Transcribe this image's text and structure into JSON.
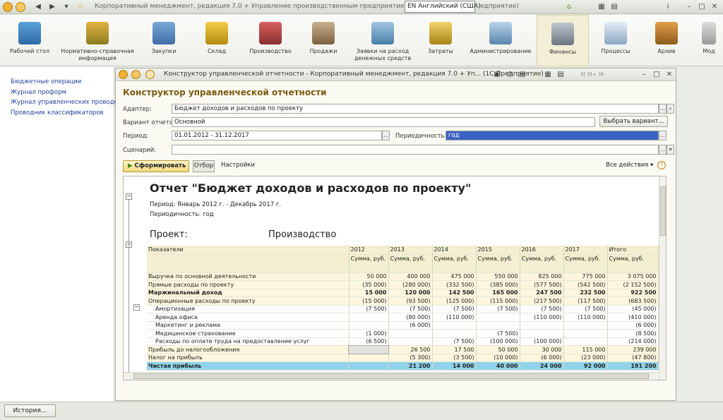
{
  "titlebar": {
    "title": "Корпоративный менеджмент, редакция 7.0 + Управление производственным предприятием, редакция 1.3",
    "language": "EN Английский (США)",
    "title_tail": "едприятие)"
  },
  "toolbar": {
    "items": [
      {
        "label": "Рабочий стол"
      },
      {
        "label": "Нормативно-справочная информация"
      },
      {
        "label": "Закупки"
      },
      {
        "label": "Склад"
      },
      {
        "label": "Производство"
      },
      {
        "label": "Продажи"
      },
      {
        "label": "Заявки на расход денежных средств"
      },
      {
        "label": "Затраты"
      },
      {
        "label": "Администрирование"
      },
      {
        "label": "Финансы"
      },
      {
        "label": "Процессы"
      },
      {
        "label": "Архив"
      },
      {
        "label": "Мод"
      }
    ]
  },
  "sidebar": {
    "items": [
      {
        "label": "Бюджетные операции"
      },
      {
        "label": "Журнал проформ"
      },
      {
        "label": "Журнал управленческих проводок"
      },
      {
        "label": "Проводник классификаторов"
      }
    ]
  },
  "window": {
    "title": "Конструктор управленческой отчетности - Корпоративный менеджмент, редакция 7.0 + Уп...  (1С:Предприятие)",
    "heading": "Конструктор управленческой отчетности",
    "adapter_label": "Адаптер:",
    "adapter_value": "Бюджет доходов и расходов по проекту",
    "variant_label": "Вариант отчета:",
    "variant_value": "Основной",
    "variant_button": "Выбрать вариант...",
    "period_label": "Период:",
    "period_value": "01.01.2012 - 31.12.2017",
    "periodicity_label": "Периодичность:",
    "periodicity_value": "год",
    "scenario_label": "Сценарий:",
    "scenario_value": "",
    "run_button": "Сформировать",
    "filter_button": "Отбор",
    "settings_button": "Настройки",
    "all_actions": "Все действия",
    "help": "?"
  },
  "report": {
    "title": "Отчет \"Бюджет доходов и расходов по проекту\"",
    "period_text": "Период: Январь 2012 г. - Декабрь 2017 г.",
    "periodicity_text": "Периодичность: год",
    "project_label": "Проект:",
    "project_value": "Производство",
    "columns": [
      "Показатели",
      "2012",
      "2013",
      "2014",
      "2015",
      "2016",
      "2017",
      "Итого"
    ],
    "subheaders": [
      "",
      "Сумма, руб.",
      "Сумма, руб.",
      "Сумма, руб.",
      "Сумма, руб.",
      "Сумма, руб.",
      "Сумма, руб.",
      "Сумма, руб."
    ],
    "rows": [
      {
        "cells": [
          "Выручка по основной деятельности",
          "50 000",
          "400 000",
          "475 000",
          "550 000",
          "825 000",
          "775 000",
          "3 075 000"
        ]
      },
      {
        "cells": [
          "Прямые расходы по проекту",
          "(35 000)",
          "(280 000)",
          "(332 500)",
          "(385 000)",
          "(577 500)",
          "(542 500)",
          "(2 152 500)"
        ]
      },
      {
        "cells": [
          "Маржинальный доход",
          "15 000",
          "120 000",
          "142 500",
          "165 000",
          "247 500",
          "232 500",
          "922 500"
        ]
      },
      {
        "cells": [
          "Операционные расходы по проекту",
          "(15 000)",
          "(93 500)",
          "(125 000)",
          "(115 000)",
          "(217 500)",
          "(117 500)",
          "(683 500)"
        ]
      },
      {
        "cells": [
          "Амортизация",
          "(7 500)",
          "(7 500)",
          "(7 500)",
          "(7 500)",
          "(7 500)",
          "(7 500)",
          "(45 000)"
        ]
      },
      {
        "cells": [
          "Аренда офиса",
          "",
          "(80 000)",
          "(110 000)",
          "",
          "(110 000)",
          "(110 000)",
          "(410 000)"
        ]
      },
      {
        "cells": [
          "Маркетинг и реклама",
          "",
          "(6 000)",
          "",
          "",
          "",
          "",
          "(6 000)"
        ]
      },
      {
        "cells": [
          "Медицинское страхование",
          "(1 000)",
          "",
          "",
          "(7 500)",
          "",
          "",
          "(8 500)"
        ]
      },
      {
        "cells": [
          "Расходы по оплате труда на предоставление услуг",
          "(6 500)",
          "",
          "(7 500)",
          "(100 000)",
          "(100 000)",
          "",
          "(214 000)"
        ]
      },
      {
        "cells": [
          "Прибыль до налогообложения",
          "",
          "26 500",
          "17 500",
          "50 000",
          "30 000",
          "115 000",
          "239 000"
        ]
      },
      {
        "cells": [
          "Налог на прибыль",
          "",
          "(5 300)",
          "(3 500)",
          "(10 000)",
          "(6 000)",
          "(23 000)",
          "(47 800)"
        ]
      },
      {
        "cells": [
          "Чистая прибыль",
          "",
          "21 200",
          "14 000",
          "40 000",
          "24 000",
          "92 000",
          "191 200"
        ]
      }
    ]
  },
  "statusbar": {
    "history_button": "История..."
  }
}
